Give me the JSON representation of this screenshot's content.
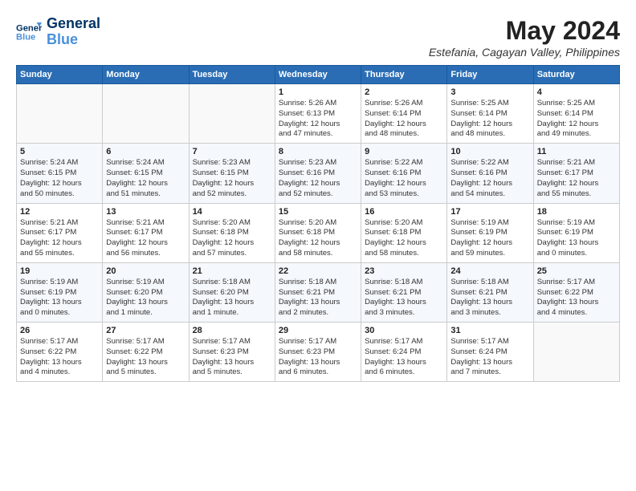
{
  "header": {
    "logo": {
      "line1": "General",
      "line2": "Blue"
    },
    "title": "May 2024",
    "location": "Estefania, Cagayan Valley, Philippines"
  },
  "days_of_week": [
    "Sunday",
    "Monday",
    "Tuesday",
    "Wednesday",
    "Thursday",
    "Friday",
    "Saturday"
  ],
  "weeks": [
    {
      "row": 1,
      "days": [
        {
          "num": "",
          "info": ""
        },
        {
          "num": "",
          "info": ""
        },
        {
          "num": "",
          "info": ""
        },
        {
          "num": "1",
          "info": "Sunrise: 5:26 AM\nSunset: 6:13 PM\nDaylight: 12 hours\nand 47 minutes."
        },
        {
          "num": "2",
          "info": "Sunrise: 5:26 AM\nSunset: 6:14 PM\nDaylight: 12 hours\nand 48 minutes."
        },
        {
          "num": "3",
          "info": "Sunrise: 5:25 AM\nSunset: 6:14 PM\nDaylight: 12 hours\nand 48 minutes."
        },
        {
          "num": "4",
          "info": "Sunrise: 5:25 AM\nSunset: 6:14 PM\nDaylight: 12 hours\nand 49 minutes."
        }
      ]
    },
    {
      "row": 2,
      "days": [
        {
          "num": "5",
          "info": "Sunrise: 5:24 AM\nSunset: 6:15 PM\nDaylight: 12 hours\nand 50 minutes."
        },
        {
          "num": "6",
          "info": "Sunrise: 5:24 AM\nSunset: 6:15 PM\nDaylight: 12 hours\nand 51 minutes."
        },
        {
          "num": "7",
          "info": "Sunrise: 5:23 AM\nSunset: 6:15 PM\nDaylight: 12 hours\nand 52 minutes."
        },
        {
          "num": "8",
          "info": "Sunrise: 5:23 AM\nSunset: 6:16 PM\nDaylight: 12 hours\nand 52 minutes."
        },
        {
          "num": "9",
          "info": "Sunrise: 5:22 AM\nSunset: 6:16 PM\nDaylight: 12 hours\nand 53 minutes."
        },
        {
          "num": "10",
          "info": "Sunrise: 5:22 AM\nSunset: 6:16 PM\nDaylight: 12 hours\nand 54 minutes."
        },
        {
          "num": "11",
          "info": "Sunrise: 5:21 AM\nSunset: 6:17 PM\nDaylight: 12 hours\nand 55 minutes."
        }
      ]
    },
    {
      "row": 3,
      "days": [
        {
          "num": "12",
          "info": "Sunrise: 5:21 AM\nSunset: 6:17 PM\nDaylight: 12 hours\nand 55 minutes."
        },
        {
          "num": "13",
          "info": "Sunrise: 5:21 AM\nSunset: 6:17 PM\nDaylight: 12 hours\nand 56 minutes."
        },
        {
          "num": "14",
          "info": "Sunrise: 5:20 AM\nSunset: 6:18 PM\nDaylight: 12 hours\nand 57 minutes."
        },
        {
          "num": "15",
          "info": "Sunrise: 5:20 AM\nSunset: 6:18 PM\nDaylight: 12 hours\nand 58 minutes."
        },
        {
          "num": "16",
          "info": "Sunrise: 5:20 AM\nSunset: 6:18 PM\nDaylight: 12 hours\nand 58 minutes."
        },
        {
          "num": "17",
          "info": "Sunrise: 5:19 AM\nSunset: 6:19 PM\nDaylight: 12 hours\nand 59 minutes."
        },
        {
          "num": "18",
          "info": "Sunrise: 5:19 AM\nSunset: 6:19 PM\nDaylight: 13 hours\nand 0 minutes."
        }
      ]
    },
    {
      "row": 4,
      "days": [
        {
          "num": "19",
          "info": "Sunrise: 5:19 AM\nSunset: 6:19 PM\nDaylight: 13 hours\nand 0 minutes."
        },
        {
          "num": "20",
          "info": "Sunrise: 5:19 AM\nSunset: 6:20 PM\nDaylight: 13 hours\nand 1 minute."
        },
        {
          "num": "21",
          "info": "Sunrise: 5:18 AM\nSunset: 6:20 PM\nDaylight: 13 hours\nand 1 minute."
        },
        {
          "num": "22",
          "info": "Sunrise: 5:18 AM\nSunset: 6:21 PM\nDaylight: 13 hours\nand 2 minutes."
        },
        {
          "num": "23",
          "info": "Sunrise: 5:18 AM\nSunset: 6:21 PM\nDaylight: 13 hours\nand 3 minutes."
        },
        {
          "num": "24",
          "info": "Sunrise: 5:18 AM\nSunset: 6:21 PM\nDaylight: 13 hours\nand 3 minutes."
        },
        {
          "num": "25",
          "info": "Sunrise: 5:17 AM\nSunset: 6:22 PM\nDaylight: 13 hours\nand 4 minutes."
        }
      ]
    },
    {
      "row": 5,
      "days": [
        {
          "num": "26",
          "info": "Sunrise: 5:17 AM\nSunset: 6:22 PM\nDaylight: 13 hours\nand 4 minutes."
        },
        {
          "num": "27",
          "info": "Sunrise: 5:17 AM\nSunset: 6:22 PM\nDaylight: 13 hours\nand 5 minutes."
        },
        {
          "num": "28",
          "info": "Sunrise: 5:17 AM\nSunset: 6:23 PM\nDaylight: 13 hours\nand 5 minutes."
        },
        {
          "num": "29",
          "info": "Sunrise: 5:17 AM\nSunset: 6:23 PM\nDaylight: 13 hours\nand 6 minutes."
        },
        {
          "num": "30",
          "info": "Sunrise: 5:17 AM\nSunset: 6:24 PM\nDaylight: 13 hours\nand 6 minutes."
        },
        {
          "num": "31",
          "info": "Sunrise: 5:17 AM\nSunset: 6:24 PM\nDaylight: 13 hours\nand 7 minutes."
        },
        {
          "num": "",
          "info": ""
        }
      ]
    }
  ]
}
